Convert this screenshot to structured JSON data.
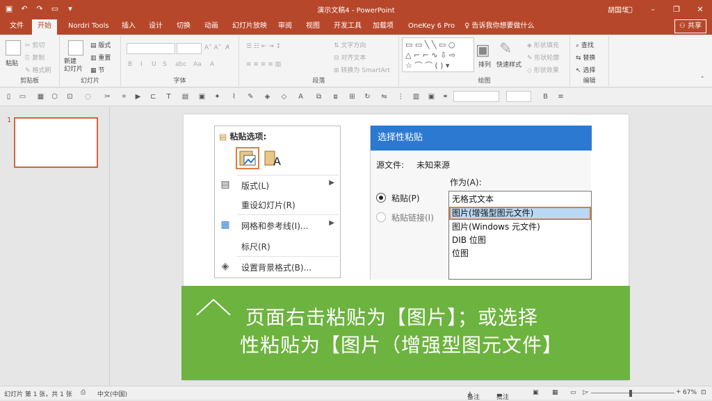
{
  "app": {
    "window_title": "演示文稿4 - PowerPoint",
    "user": "胡国华",
    "share_label": "共享"
  },
  "tabs": [
    "文件",
    "开始",
    "Nordri Tools",
    "插入",
    "设计",
    "切换",
    "动画",
    "幻灯片放映",
    "审阅",
    "视图",
    "开发工具",
    "加载项",
    "OneKey 6 Pro"
  ],
  "active_tab": "开始",
  "tell_me": "告诉我你想要做什么",
  "ribbon": {
    "clipboard": {
      "paste": "粘贴",
      "cut": "剪切",
      "copy": "复制",
      "format_painter": "格式刷",
      "label": "剪贴板"
    },
    "slides": {
      "new_slide": "新建\n幻灯片",
      "layout": "版式",
      "reset": "重置",
      "section": "节",
      "label": "幻灯片"
    },
    "font": {
      "label": "字体"
    },
    "paragraph": {
      "text_direction": "文字方向",
      "align_text": "对齐文本",
      "smartart": "转换为 SmartArt",
      "label": "段落"
    },
    "drawing": {
      "arrange": "排列",
      "quick_styles": "快速样式",
      "shape_fill": "形状填充",
      "shape_outline": "形状轮廓",
      "shape_effects": "形状效果",
      "label": "绘图"
    },
    "editing": {
      "find": "查找",
      "replace": "替换",
      "select": "选择",
      "label": "编辑"
    }
  },
  "thumbnail": {
    "number": "1"
  },
  "context_menu": {
    "header": "粘贴选项:",
    "items": [
      {
        "label": "版式(L)",
        "has_submenu": true,
        "icon": "layout-icon"
      },
      {
        "label": "重设幻灯片(R)",
        "has_submenu": false,
        "icon": ""
      },
      {
        "label": "网格和参考线(I)...",
        "has_submenu": true,
        "icon": "grid-icon"
      },
      {
        "label": "标尺(R)",
        "has_submenu": false,
        "icon": ""
      },
      {
        "label": "设置背景格式(B)...",
        "has_submenu": false,
        "icon": "background-format-icon"
      }
    ]
  },
  "paste_special": {
    "title": "选择性粘贴",
    "source_label": "源文件:",
    "source_value": "未知来源",
    "as_label": "作为(A):",
    "radio_paste": "粘贴(P)",
    "radio_link": "粘贴链接(I)",
    "options": [
      "无格式文本",
      "图片(增强型图元文件)",
      "图片(Windows 元文件)",
      "DIB 位图",
      "位图"
    ],
    "selected_index": 1
  },
  "banner": {
    "line1": "页面右击粘贴为【图片】；或选择",
    "line2": "性粘贴为【图片（增强型图元文件】",
    "bg_color": "#6db33f"
  },
  "status": {
    "slide_info": "幻灯片 第 1 张，共 1 张",
    "language": "中文(中国)",
    "notes": "备注",
    "comments": "批注",
    "zoom": "67%"
  },
  "accent_color": "#b7472a"
}
